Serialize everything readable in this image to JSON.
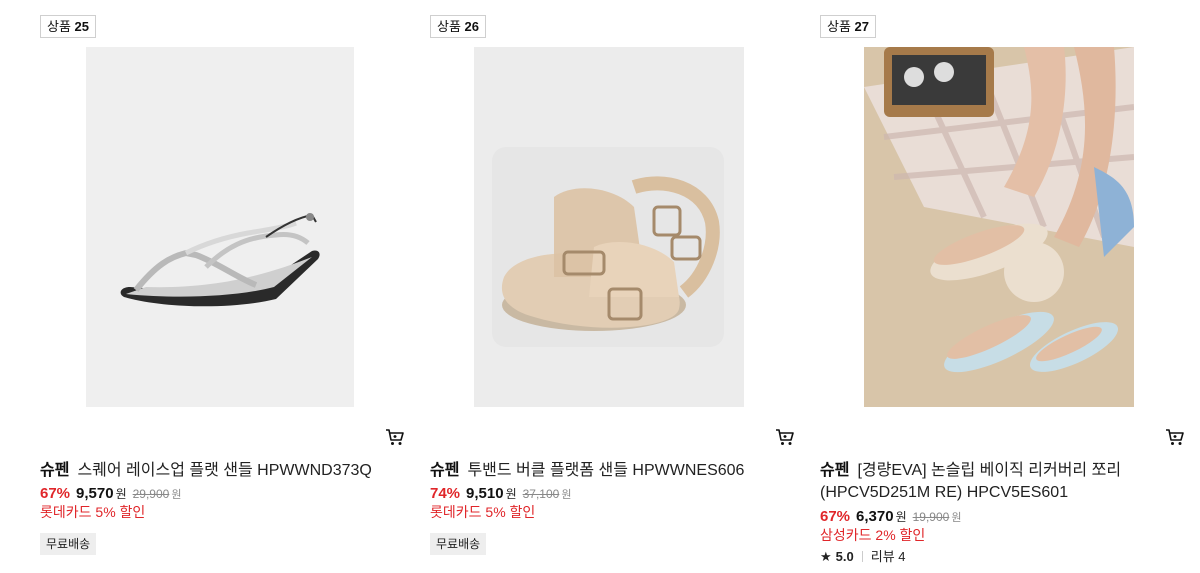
{
  "products": [
    {
      "badge_prefix": "상품",
      "badge_num": "25",
      "brand": "슈펜",
      "name": "스퀘어 레이스업 플랫 샌들 HPWWND373Q",
      "discount": "67%",
      "price": "9,570",
      "currency": "원",
      "original_price": "29,900",
      "original_currency": "원",
      "promo": "롯데카드 5% 할인",
      "shipping": "무료배송",
      "image_icon": "silver-strappy-sandal"
    },
    {
      "badge_prefix": "상품",
      "badge_num": "26",
      "brand": "슈펜",
      "name": "투밴드 버클 플랫폼 샌들 HPWWNES606",
      "discount": "74%",
      "price": "9,510",
      "currency": "원",
      "original_price": "37,100",
      "original_currency": "원",
      "promo": "롯데카드 5% 할인",
      "shipping": "무료배송",
      "image_icon": "beige-buckle-sandal"
    },
    {
      "badge_prefix": "상품",
      "badge_num": "27",
      "brand": "슈펜",
      "name_line1": "[경량EVA] 논슬립 베이직 리커버리 쪼리",
      "name_line2": "(HPCV5D251M RE) HPCV5ES601",
      "discount": "67%",
      "price": "6,370",
      "currency": "원",
      "original_price": "19,900",
      "original_currency": "원",
      "promo": "삼성카드 2% 할인",
      "rating_score": "5.0",
      "review_label": "리뷰 4",
      "image_icon": "flip-flops-beach-photo"
    }
  ]
}
